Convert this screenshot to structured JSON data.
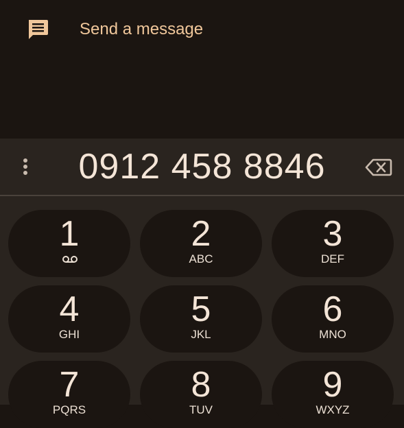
{
  "message": {
    "label": "Send a message",
    "icon": "message-icon"
  },
  "display": {
    "number": "0912 458 8846"
  },
  "keys": [
    {
      "digit": "1",
      "letters": ""
    },
    {
      "digit": "2",
      "letters": "ABC"
    },
    {
      "digit": "3",
      "letters": "DEF"
    },
    {
      "digit": "4",
      "letters": "GHI"
    },
    {
      "digit": "5",
      "letters": "JKL"
    },
    {
      "digit": "6",
      "letters": "MNO"
    },
    {
      "digit": "7",
      "letters": "PQRS"
    },
    {
      "digit": "8",
      "letters": "TUV"
    },
    {
      "digit": "9",
      "letters": "WXYZ"
    }
  ],
  "colors": {
    "background": "#1b1511",
    "dialer_background": "#2a241f",
    "accent": "#f0c79b",
    "text": "#f4e5d7"
  }
}
